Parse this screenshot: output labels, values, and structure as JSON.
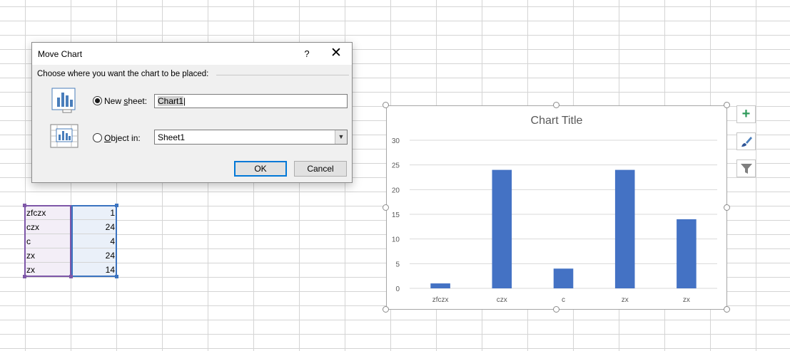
{
  "dialog": {
    "title": "Move Chart",
    "help": "?",
    "close": "✕",
    "prompt": "Choose where you want the chart to be placed:",
    "new_sheet": {
      "label_pre": "New ",
      "label_key": "s",
      "label_post": "heet:",
      "value": "Chart1",
      "selected": true
    },
    "object_in": {
      "label_key": "O",
      "label_post": "bject in:",
      "value": "Sheet1",
      "selected": false
    },
    "ok_label": "OK",
    "cancel_label": "Cancel"
  },
  "cells": [
    {
      "label": "zfczx",
      "value": "1"
    },
    {
      "label": "czx",
      "value": "24"
    },
    {
      "label": "c",
      "value": "4"
    },
    {
      "label": "zx",
      "value": "24"
    },
    {
      "label": "zx",
      "value": "14"
    }
  ],
  "chart_data": {
    "type": "bar",
    "title": "Chart Title",
    "categories": [
      "zfczx",
      "czx",
      "c",
      "zx",
      "zx"
    ],
    "values": [
      1,
      24,
      4,
      24,
      14
    ],
    "ylim": [
      0,
      30
    ],
    "yticks": [
      "0",
      "5",
      "10",
      "15",
      "20",
      "25",
      "30"
    ],
    "grid": true,
    "bar_color": "#4472c4"
  },
  "side_buttons": [
    "plus-icon",
    "brush-icon",
    "filter-icon"
  ]
}
